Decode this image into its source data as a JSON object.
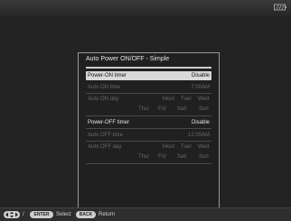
{
  "dialog": {
    "title": "Auto Power ON/OFF - Simple",
    "power_on": {
      "timer_label": "Power-ON timer",
      "timer_value": "Disable",
      "time_label": "Auto ON time",
      "time_value": "7:00AM",
      "day_label": "Auto ON day",
      "days_line1": [
        "Mon/",
        "Tue/",
        "Wed"
      ],
      "days_line2": [
        "Thu/",
        "Fri/",
        "Sat/",
        "Sun"
      ]
    },
    "power_off": {
      "timer_label": "Power-OFF timer",
      "timer_value": "Disable",
      "time_label": "Auto OFF time",
      "time_value": "12:00AM",
      "day_label": "Auto OFF day",
      "days_line1": [
        "Mon/",
        "Tue/",
        "Wed"
      ],
      "days_line2": [
        "Thu/",
        "Fri/",
        "Sat/",
        "Sun"
      ]
    }
  },
  "bottom_bar": {
    "nav_slash": "/",
    "enter_key": "ENTER",
    "select_label": "Select",
    "back_key": "BACK",
    "return_label": "Return"
  },
  "colors": {
    "background": "#232323",
    "selected_row": "#d9d9d9",
    "text_enabled": "#e6e6e6",
    "text_disabled": "#6a6a6a"
  },
  "icons": {
    "battery": "battery-icon",
    "dpad": "dpad-icon"
  }
}
